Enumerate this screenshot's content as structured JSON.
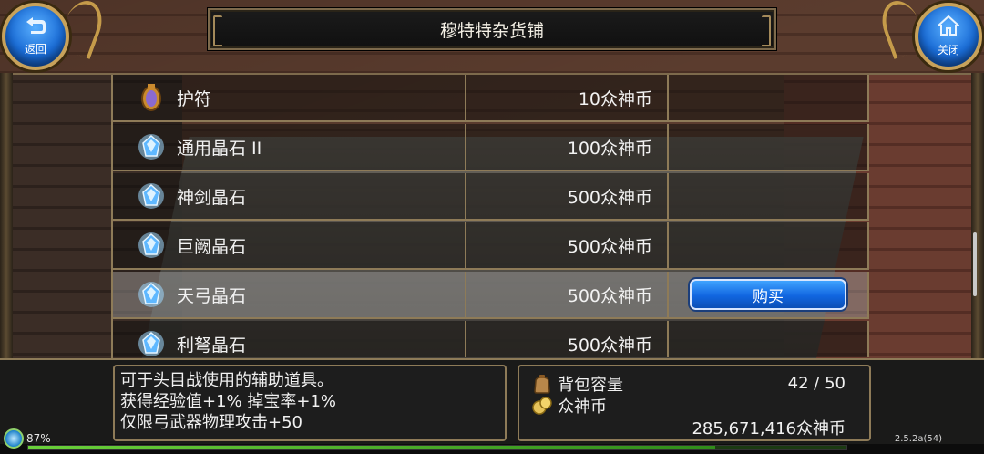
{
  "header": {
    "title": "穆特特杂货铺",
    "back_label": "返回",
    "close_label": "关闭"
  },
  "items": [
    {
      "name": "护符",
      "price": "10众神币",
      "icon": "amulet-icon"
    },
    {
      "name": "通用晶石 II",
      "price": "100众神币",
      "icon": "crystal-icon"
    },
    {
      "name": "神剑晶石",
      "price": "500众神币",
      "icon": "crystal-icon"
    },
    {
      "name": "巨阙晶石",
      "price": "500众神币",
      "icon": "crystal-icon"
    },
    {
      "name": "天弓晶石",
      "price": "500众神币",
      "icon": "crystal-icon",
      "selected": true
    },
    {
      "name": "利弩晶石",
      "price": "500众神币",
      "icon": "crystal-icon"
    }
  ],
  "buy_label": "购买",
  "description": {
    "line1": "可于头目战使用的辅助道具。",
    "line2": "获得经验值+1% 掉宝率+1%",
    "line3": "仅限弓武器物理攻击+50"
  },
  "stats": {
    "bag_label": "背包容量",
    "bag_value": "42 / 50",
    "currency_label": "众神币",
    "currency_value": "285,671,416众神币"
  },
  "status": {
    "battery": "87%",
    "exp_fraction": 0.84,
    "version": "2.5.2a(54)"
  },
  "colors": {
    "accent_blue": "#1166e0",
    "frame_gold": "#8e7b58"
  }
}
